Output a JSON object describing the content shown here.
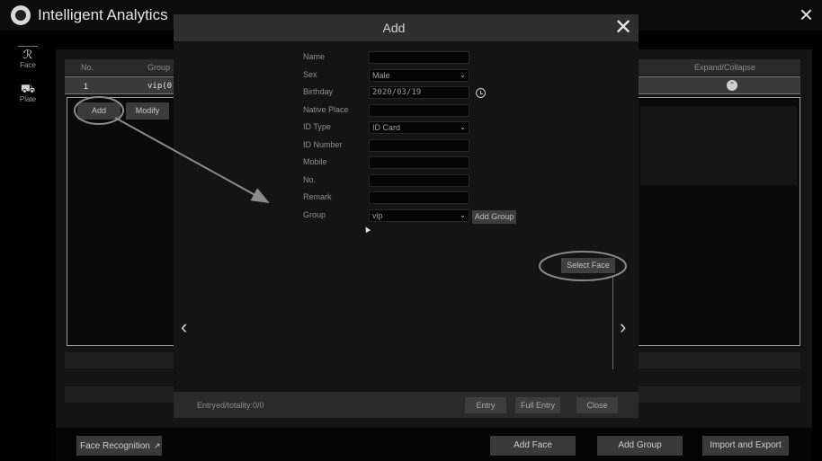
{
  "app": {
    "title": "Intelligent Analytics",
    "close_icon": "×"
  },
  "sidebar": {
    "items": [
      {
        "label": "Face",
        "icon": "face-icon",
        "glyph": "ℛ"
      },
      {
        "label": "Plate",
        "icon": "car-icon",
        "glyph": "⛟"
      }
    ]
  },
  "table": {
    "headers": {
      "no": "No.",
      "group": "Group",
      "expand": "Expand/Collapse"
    },
    "rows": [
      {
        "no": "1",
        "group": "vip(0)"
      }
    ],
    "add_label": "Add",
    "modify_label": "Modify"
  },
  "bottom": {
    "face_recognition": "Face Recognition",
    "face_recognition_arrow": "↗",
    "add_face": "Add Face",
    "add_group": "Add Group",
    "import_export": "Import and Export"
  },
  "modal": {
    "title": "Add",
    "close_icon": "✕",
    "fields": {
      "name": {
        "label": "Name",
        "value": ""
      },
      "sex": {
        "label": "Sex",
        "value": "Male"
      },
      "birthday": {
        "label": "Birthday",
        "value": "2020/03/19"
      },
      "native_place": {
        "label": "Native Place",
        "value": ""
      },
      "id_type": {
        "label": "ID Type",
        "value": "ID Card"
      },
      "id_number": {
        "label": "ID Number",
        "value": ""
      },
      "mobile": {
        "label": "Mobile",
        "value": ""
      },
      "no": {
        "label": "No.",
        "value": ""
      },
      "remark": {
        "label": "Remark",
        "value": ""
      },
      "group": {
        "label": "Group",
        "value": "vip"
      }
    },
    "add_group_button": "Add Group",
    "select_face_button": "Select Face",
    "prev_icon": "‹",
    "next_icon": "›",
    "footer": {
      "status": "Entryed/totality:0/0",
      "entry": "Entry",
      "full_entry": "Full Entry",
      "close": "Close"
    }
  },
  "colors": {
    "background": "#000000",
    "panel": "#141414",
    "button": "#3b3b3b",
    "annotation": "#8a8a8a"
  }
}
